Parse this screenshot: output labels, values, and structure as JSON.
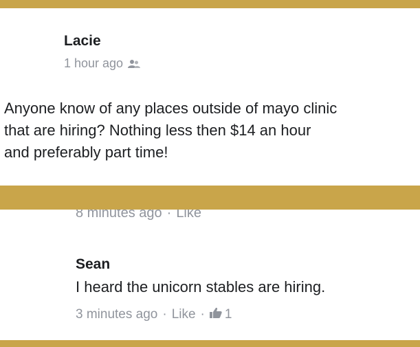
{
  "post": {
    "author": "Lacie",
    "timestamp": "1 hour ago",
    "audience_icon": "friends-icon",
    "text_lines": [
      "Anyone know of any places outside of mayo clinic",
      "that are hiring?  Nothing less then $14 an hour",
      "and preferably part time!"
    ]
  },
  "previous_comment": {
    "timestamp": "8 minutes ago",
    "separator": "·",
    "like_label": "Like"
  },
  "comment": {
    "author": "Sean",
    "text": "I heard the unicorn stables are hiring.",
    "timestamp": "3 minutes ago",
    "separator": "·",
    "like_label": "Like",
    "like_icon": "thumbs-up-icon",
    "like_count": "1"
  },
  "colors": {
    "background_band": "#c9a54a",
    "card": "#ffffff",
    "text": "#1c1e21",
    "meta": "#90949c"
  }
}
